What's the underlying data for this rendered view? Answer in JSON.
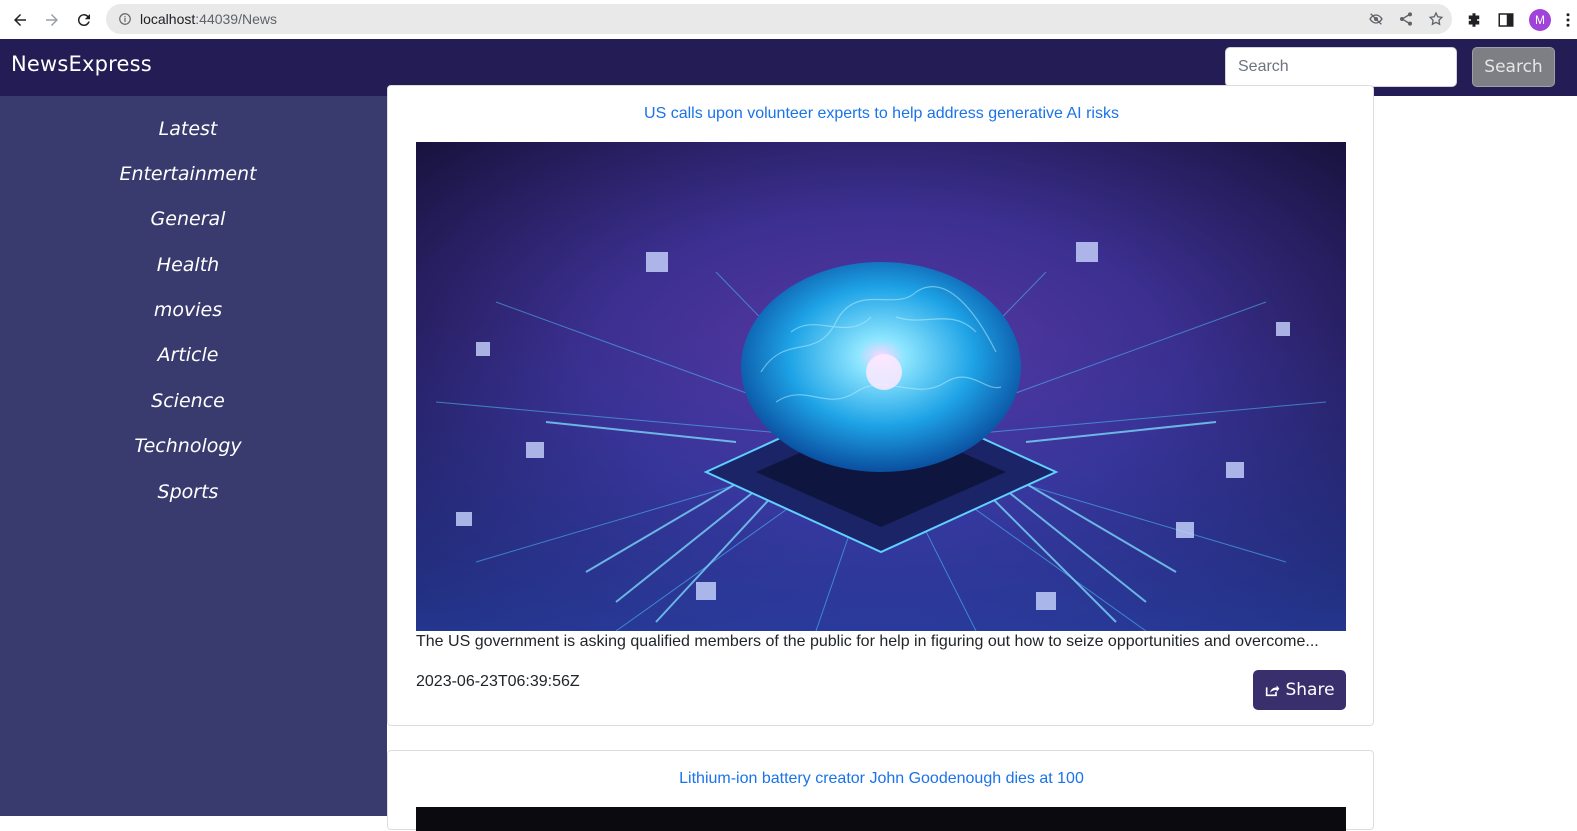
{
  "browser": {
    "url_host": "localhost",
    "url_port_path": ":44039/News",
    "avatar_letter": "M"
  },
  "navbar": {
    "brand": "NewsExpress",
    "search_placeholder": "Search",
    "search_button": "Search"
  },
  "sidebar": {
    "items": [
      {
        "label": "Latest"
      },
      {
        "label": "Entertainment"
      },
      {
        "label": "General"
      },
      {
        "label": "Health"
      },
      {
        "label": "movies"
      },
      {
        "label": "Article"
      },
      {
        "label": "Science"
      },
      {
        "label": "Technology"
      },
      {
        "label": "Sports"
      }
    ]
  },
  "articles": [
    {
      "title": "US calls upon volunteer experts to help address generative AI risks",
      "description": "The US government is asking qualified members of the public for help in figuring out how to seize opportunities and overcome...",
      "date": "2023-06-23T06:39:56Z",
      "share_label": "Share",
      "image": "ai-brain-circuit-image"
    },
    {
      "title": "Lithium-ion battery creator John Goodenough dies at 100",
      "image": "dark-image"
    }
  ],
  "colors": {
    "navbar": "#241c54",
    "sidebar": "#393b6e",
    "link": "#1a73e8",
    "share_button": "#3a2f6d"
  }
}
